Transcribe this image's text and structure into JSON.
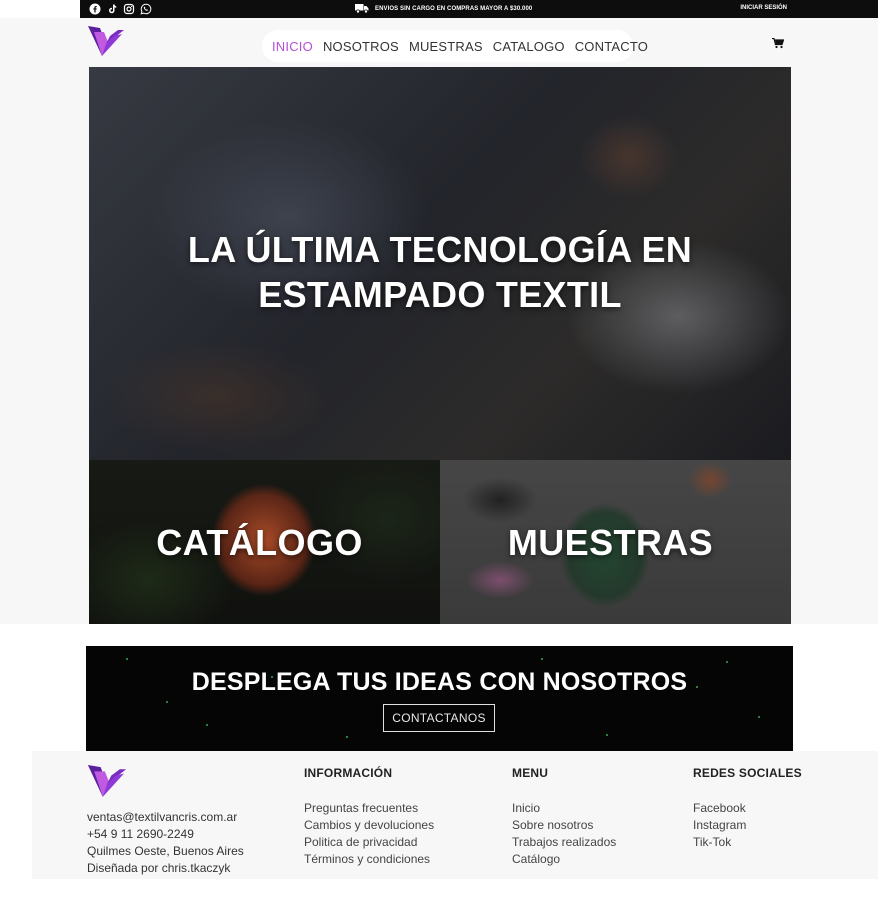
{
  "topbar": {
    "socials": [
      "facebook-icon",
      "tiktok-icon",
      "instagram-icon",
      "whatsapp-icon"
    ],
    "shipping_text": "ENVIOS SIN CARGO EN COMPRAS MAYOR A $30.000",
    "login": "INICIAR SESIÓN"
  },
  "nav": {
    "items": [
      {
        "label": "INICIO",
        "active": true
      },
      {
        "label": "NOSOTROS",
        "active": false
      },
      {
        "label": "MUESTRAS",
        "active": false
      },
      {
        "label": "CATALOGO",
        "active": false
      },
      {
        "label": "CONTACTO",
        "active": false
      }
    ],
    "cart_icon": "cart-icon"
  },
  "hero": {
    "line1": "LA ÚLTIMA TECNOLOGÍA EN",
    "line2": "ESTAMPADO TEXTIL"
  },
  "tiles": {
    "catalog": "CATÁLOGO",
    "samples": "MUESTRAS"
  },
  "banner": {
    "title": "DESPLEGA TUS IDEAS CON NOSOTROS",
    "button": "CONTACTANOS"
  },
  "footer": {
    "contact": {
      "email": "ventas@textilvancris.com.ar",
      "phone": "+54 9 11 2690-2249",
      "address": "Quilmes Oeste, Buenos Aires",
      "credit": "Diseñada por chris.tkaczyk"
    },
    "info": {
      "title": "INFORMACIÓN",
      "links": [
        "Preguntas frecuentes",
        "Cambios y devoluciones",
        "Politica de privacidad",
        "Términos y condiciones"
      ]
    },
    "menu": {
      "title": "MENU",
      "links": [
        "Inicio",
        "Sobre nosotros",
        "Trabajos realizados",
        "Catálogo"
      ]
    },
    "social": {
      "title": "REDES SOCIALES",
      "links": [
        "Facebook",
        "Instagram",
        "Tik-Tok"
      ]
    }
  },
  "colors": {
    "accent": "#b24fd4",
    "logo_dark": "#5b1fa0",
    "logo_light": "#c05ae0",
    "topbar": "#0d0d0d"
  }
}
